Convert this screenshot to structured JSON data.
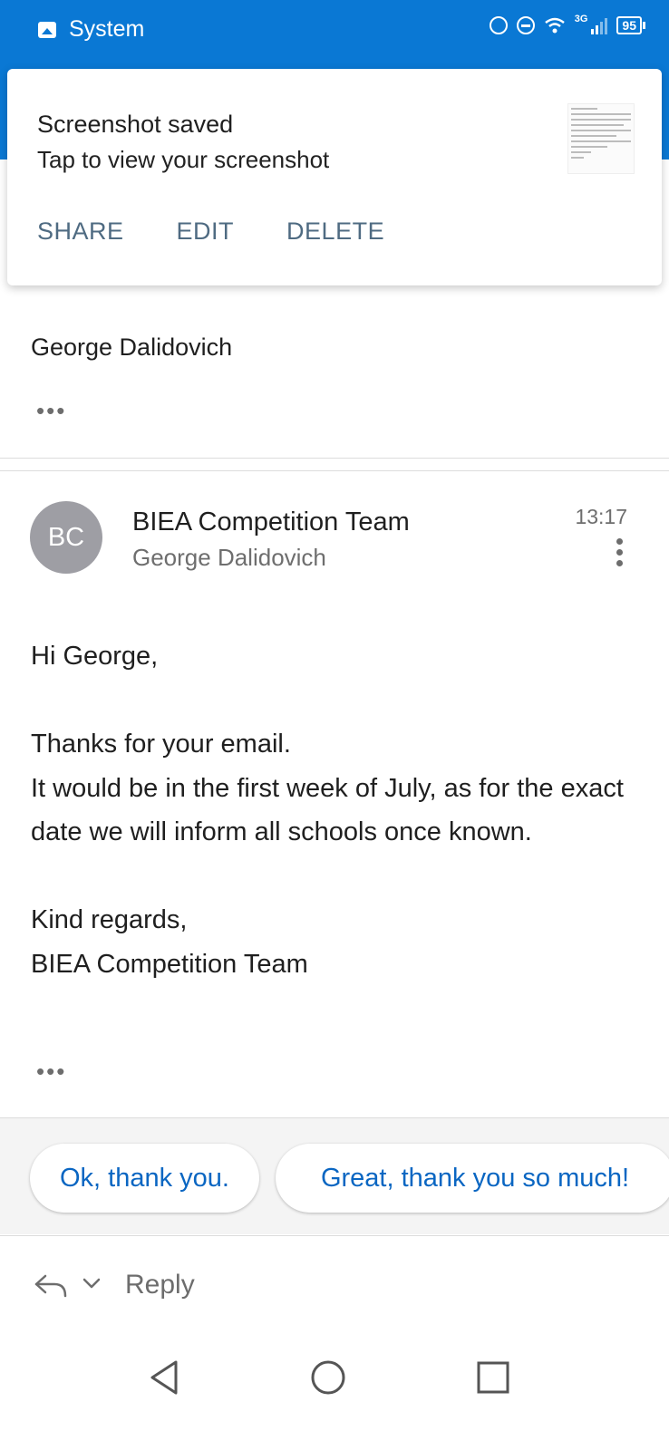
{
  "status_bar": {
    "app_name": "System",
    "network": "3G",
    "battery": "95",
    "icons": [
      "image-icon",
      "alarm-icon",
      "do-not-disturb-icon",
      "wifi-icon",
      "signal-icon",
      "battery-icon"
    ]
  },
  "toast": {
    "title": "Screenshot saved",
    "subtitle": "Tap to view your screenshot",
    "actions": [
      "SHARE",
      "EDIT",
      "DELETE"
    ]
  },
  "previous_message": {
    "sender": "George Dalidovich"
  },
  "message": {
    "avatar_initials": "BC",
    "sender": "BIEA Competition Team",
    "recipient": "George Dalidovich",
    "time": "13:17",
    "greeting": "Hi George,",
    "lines": [
      "Thanks for your email.",
      "It would be in the first week of July, as for the exact date we will inform all schools once known."
    ],
    "signoff": "Kind regards,",
    "signature": "BIEA Competition Team"
  },
  "quick_replies": [
    "Ok, thank you.",
    "Great, thank you so much!"
  ],
  "reply_bar": {
    "label": "Reply"
  },
  "colors": {
    "accent": "#0a78d4",
    "link": "#0a66c2",
    "avatar": "#9e9ea4"
  }
}
